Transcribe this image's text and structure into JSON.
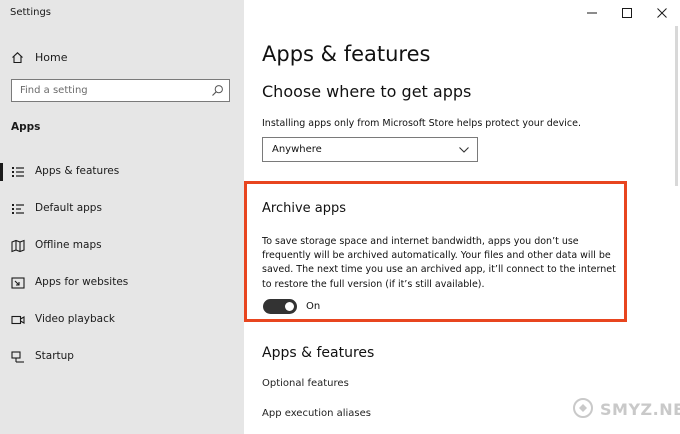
{
  "window": {
    "title": "Settings"
  },
  "sidebar": {
    "home": "Home",
    "search_placeholder": "Find a setting",
    "section": "Apps",
    "items": [
      {
        "label": "Apps & features",
        "icon": "list-icon",
        "selected": true
      },
      {
        "label": "Default apps",
        "icon": "default-apps-icon",
        "selected": false
      },
      {
        "label": "Offline maps",
        "icon": "map-icon",
        "selected": false
      },
      {
        "label": "Apps for websites",
        "icon": "website-icon",
        "selected": false
      },
      {
        "label": "Video playback",
        "icon": "video-icon",
        "selected": false
      },
      {
        "label": "Startup",
        "icon": "startup-icon",
        "selected": false
      }
    ]
  },
  "main": {
    "title": "Apps & features",
    "choose": {
      "heading": "Choose where to get apps",
      "description": "Installing apps only from Microsoft Store helps protect your device.",
      "dropdown_value": "Anywhere"
    },
    "archive": {
      "heading": "Archive apps",
      "description": "To save storage space and internet bandwidth, apps you don’t use frequently will be archived automatically. Your files and other data will be saved. The next time you use an archived app, it’ll connect to the internet to restore the full version (if it’s still available).",
      "toggle_label": "On",
      "toggle_on": true,
      "highlight_color": "#e8451f"
    },
    "apps_features": {
      "heading": "Apps & features",
      "links": [
        "Optional features",
        "App execution aliases"
      ]
    }
  },
  "watermark": {
    "text": "SMYZ.NET"
  }
}
